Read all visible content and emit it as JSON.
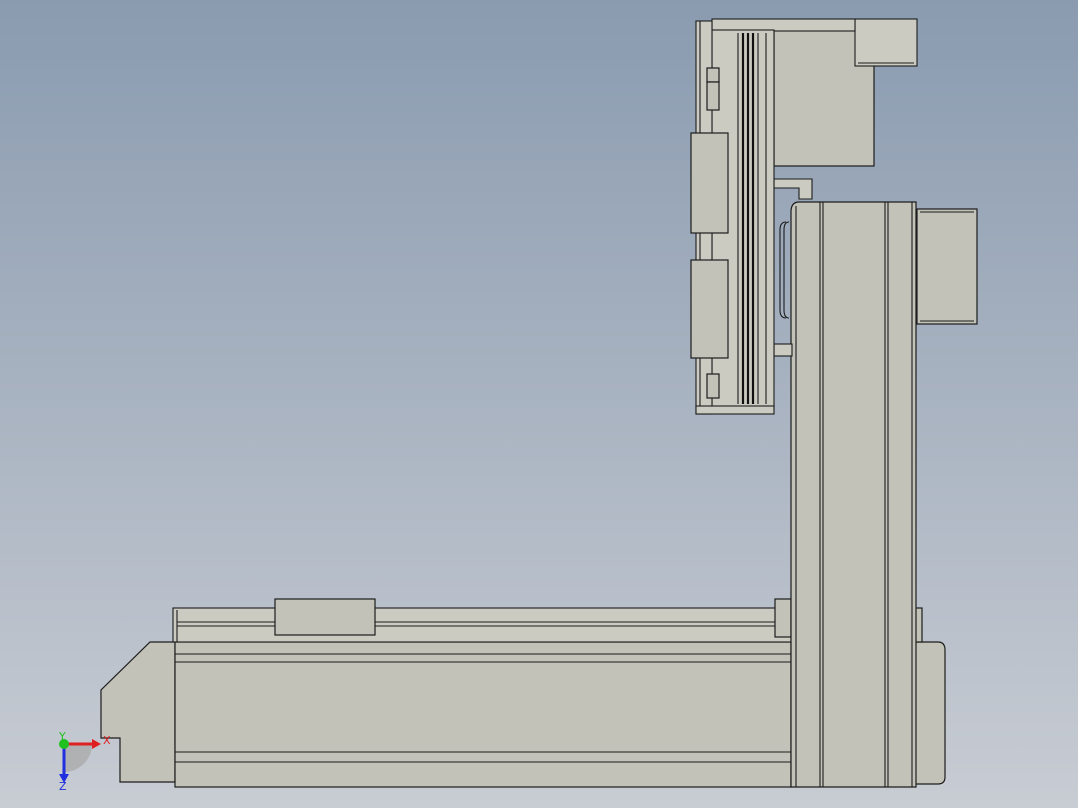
{
  "viewport": {
    "background_top": "#8a9bb0",
    "background_bottom": "#c8ccd3",
    "part_color": "#c2c2b8",
    "edge_color": "#1c1c1c"
  },
  "triad": {
    "x_label": "X",
    "y_label": "Y",
    "z_label": "Z",
    "x_color": "#e02020",
    "y_color": "#20c020",
    "z_color": "#2030e0"
  }
}
